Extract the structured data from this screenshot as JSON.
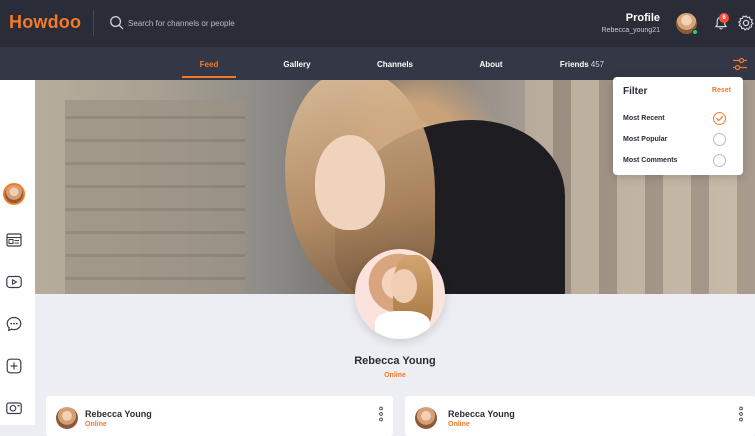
{
  "app": {
    "logo": "Howdoo"
  },
  "search": {
    "placeholder": "Search for channels or people"
  },
  "profile": {
    "title": "Profile",
    "username": "Rebecca_young21"
  },
  "notifications": {
    "count": "6"
  },
  "tabs": [
    {
      "label": "Feed",
      "active": true
    },
    {
      "label": "Gallery",
      "active": false
    },
    {
      "label": "Channels",
      "active": false
    },
    {
      "label": "About",
      "active": false
    },
    {
      "label": "Friends",
      "count": "457",
      "active": false
    }
  ],
  "sidebar": {
    "icons": [
      "avatar",
      "news-icon",
      "video-icon",
      "chat-icon",
      "add-icon",
      "camera-icon"
    ]
  },
  "user": {
    "name": "Rebecca Young",
    "status": "Online"
  },
  "filter": {
    "title": "Filter",
    "reset": "Reset",
    "options": [
      {
        "label": "Most Recent",
        "checked": true
      },
      {
        "label": "Most Popular",
        "checked": false
      },
      {
        "label": "Most Comments",
        "checked": false
      }
    ]
  },
  "posts": [
    {
      "name": "Rebecca Young",
      "status": "Online"
    },
    {
      "name": "Rebecca Young",
      "status": "Online"
    }
  ],
  "colors": {
    "accent": "#f47a2a",
    "dark": "#2a2c38",
    "nav": "#343745"
  }
}
